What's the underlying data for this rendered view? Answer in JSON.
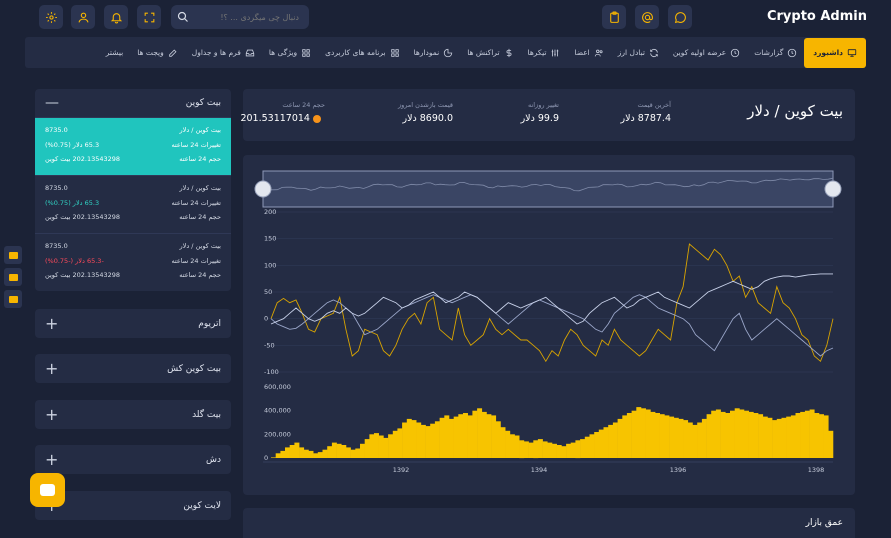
{
  "app": {
    "title": "Crypto Admin"
  },
  "search": {
    "placeholder": "دنبال چی میگردی ... ؟!"
  },
  "nav": {
    "items": [
      {
        "label": "داشبورد",
        "icon": "monitor-icon",
        "active": true
      },
      {
        "label": "گزارشات",
        "icon": "clock-icon"
      },
      {
        "label": "عرضه اولیه کوین",
        "icon": "clock-icon"
      },
      {
        "label": "تبادل ارز",
        "icon": "refresh-icon"
      },
      {
        "label": "اعضا",
        "icon": "users-icon"
      },
      {
        "label": "تیکرها",
        "icon": "sliders-icon"
      },
      {
        "label": "تراکنش ها",
        "icon": "dollar-icon"
      },
      {
        "label": "نمودارها",
        "icon": "pie-chart-icon"
      },
      {
        "label": "برنامه های کاربردی",
        "icon": "grid-icon"
      },
      {
        "label": "ویژگی ها",
        "icon": "grid-icon"
      },
      {
        "label": "فرم ها و جداول",
        "icon": "inbox-icon"
      },
      {
        "label": "ویجت ها",
        "icon": "edit-icon"
      },
      {
        "label": "بیشتر",
        "icon": ""
      }
    ]
  },
  "sidebar": {
    "expanded": {
      "title": "بیت کوین",
      "rows": [
        {
          "pair": "بیت کوین / دلار",
          "price": "8735.0",
          "change_label": "تغییرات 24 ساعته",
          "change": "65.3 دلار (0.75%)",
          "direction": "up",
          "volume_label": "حجم 24 ساعته",
          "volume": "202.13543298 بیت کوین"
        },
        {
          "pair": "بیت کوین / دلار",
          "price": "8735.0",
          "change_label": "تغییرات 24 ساعته",
          "change": "65.3 دلار (0.75%)",
          "direction": "up",
          "volume_label": "حجم 24 ساعته",
          "volume": "202.13543298 بیت کوین"
        },
        {
          "pair": "بیت کوین / دلار",
          "price": "8735.0",
          "change_label": "تغییرات 24 ساعته",
          "change": "-65.3 دلار (-0.75%)",
          "direction": "down",
          "volume_label": "حجم 24 ساعته",
          "volume": "202.13543298 بیت کوین"
        }
      ]
    },
    "collapsed": [
      "اتریوم",
      "بیت کوین کش",
      "بیت گلد",
      "دش",
      "لایت کوین"
    ]
  },
  "stats": {
    "title": "بیت کوین / دلار",
    "items": [
      {
        "label": "آخرین قیمت",
        "value": "8787.4 دلار"
      },
      {
        "label": "تغییر روزانه",
        "value": "99.9 دلار"
      },
      {
        "label": "قیمت بازشدن امروز",
        "value": "8690.0 دلار"
      },
      {
        "label": "حجم 24 ساعت",
        "value": "201.53117014"
      }
    ]
  },
  "chart_data": {
    "type": "line",
    "x_ticks": [
      "1392",
      "1394",
      "1396",
      "1398"
    ],
    "y_ticks": [
      "200",
      "150",
      "100",
      "50",
      "0",
      "-50",
      "-100"
    ],
    "ylim": [
      -100,
      200
    ],
    "series": [
      {
        "color": "#d9a400",
        "values": [
          0,
          30,
          38,
          30,
          35,
          10,
          -20,
          -25,
          0,
          5,
          10,
          40,
          -20,
          -70,
          -60,
          -20,
          -25,
          -30,
          -60,
          -70,
          -50,
          -20,
          0,
          10,
          -10,
          30,
          40,
          -20,
          -30,
          -40,
          20,
          -30,
          -50,
          -40,
          -30,
          0,
          -20,
          -30,
          -20,
          -30,
          -40,
          -40,
          -50,
          -60,
          -80,
          -60,
          -70,
          -40,
          -20,
          -30,
          -50,
          -60,
          -70,
          -40,
          -50,
          -20,
          -40,
          -50,
          -60,
          -70,
          -60,
          -40,
          -20,
          -30,
          -40,
          30,
          60,
          140,
          130,
          120,
          110,
          130,
          120,
          100,
          70,
          80,
          40,
          60,
          30,
          20,
          10,
          60,
          30,
          20,
          0,
          -30,
          -40,
          -70,
          -80,
          -50,
          0
        ]
      },
      {
        "color": "#9aa6c9",
        "values": [
          0,
          -10,
          -15,
          -20,
          -18,
          -10,
          0,
          10,
          20,
          30,
          35,
          30,
          20,
          10,
          -10,
          -30,
          -25,
          -20,
          -10,
          0,
          10,
          20,
          25,
          30,
          35,
          40,
          45,
          40,
          35,
          30,
          35,
          40,
          45,
          40,
          30,
          20,
          10,
          0,
          -10,
          0,
          10,
          20,
          30,
          35,
          30,
          25,
          20,
          15,
          10,
          5,
          0,
          -10,
          -20,
          -25,
          -10,
          10,
          20,
          30,
          40,
          45,
          40,
          30,
          20,
          15,
          10,
          5,
          0,
          -10,
          -30,
          -40,
          -50,
          -60,
          -40,
          -20,
          0,
          10,
          -20,
          -40,
          -30,
          -20,
          -10,
          0,
          -10,
          -20,
          -30,
          -40,
          -50,
          -60,
          -70,
          -60,
          -55
        ]
      },
      {
        "color": "#c7d0e8",
        "values": [
          -10,
          -5,
          0,
          10,
          20,
          10,
          0,
          -5,
          0,
          10,
          15,
          10,
          20,
          10,
          5,
          10,
          20,
          30,
          40,
          35,
          30,
          20,
          25,
          35,
          40,
          45,
          50,
          40,
          30,
          35,
          40,
          50,
          45,
          40,
          30,
          20,
          10,
          20,
          30,
          25,
          20,
          25,
          30,
          35,
          40,
          30,
          20,
          10,
          0,
          -10,
          -5,
          10,
          20,
          30,
          35,
          40,
          30,
          20,
          25,
          35,
          40,
          45,
          50,
          40,
          35,
          30,
          25,
          20,
          30,
          40,
          50,
          55,
          60,
          65,
          70,
          65,
          60,
          55,
          60,
          70,
          75,
          78,
          80,
          80,
          78,
          80,
          82,
          83,
          84,
          84,
          84
        ]
      }
    ],
    "volume": {
      "color": "#f7c400",
      "y_ticks": [
        "600,000",
        "400,000",
        "200,000",
        "0"
      ],
      "ylim": [
        0,
        600000
      ],
      "values": [
        5000,
        40000,
        60000,
        90000,
        110000,
        130000,
        90000,
        70000,
        60000,
        40000,
        50000,
        70000,
        100000,
        130000,
        120000,
        110000,
        90000,
        70000,
        80000,
        120000,
        160000,
        200000,
        210000,
        190000,
        170000,
        200000,
        230000,
        250000,
        300000,
        330000,
        320000,
        300000,
        280000,
        270000,
        290000,
        310000,
        340000,
        360000,
        330000,
        350000,
        370000,
        380000,
        360000,
        400000,
        420000,
        390000,
        370000,
        360000,
        310000,
        260000,
        230000,
        200000,
        190000,
        150000,
        140000,
        130000,
        150000,
        160000,
        140000,
        130000,
        120000,
        110000,
        100000,
        120000,
        130000,
        150000,
        160000,
        180000,
        200000,
        220000,
        240000,
        260000,
        280000,
        300000,
        330000,
        360000,
        380000,
        400000,
        430000,
        420000,
        410000,
        390000,
        380000,
        370000,
        360000,
        350000,
        340000,
        330000,
        320000,
        300000,
        280000,
        300000,
        330000,
        370000,
        400000,
        410000,
        390000,
        380000,
        400000,
        420000,
        410000,
        400000,
        390000,
        380000,
        370000,
        350000,
        340000,
        320000,
        330000,
        340000,
        350000,
        360000,
        380000,
        390000,
        400000,
        410000,
        380000,
        370000,
        360000,
        230000
      ]
    }
  }
}
